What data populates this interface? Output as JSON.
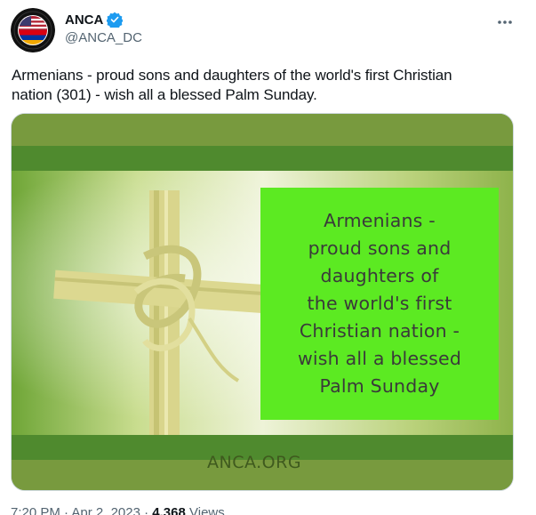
{
  "author": {
    "display_name": "ANCA",
    "handle": "@ANCA_DC",
    "verified": true,
    "avatar_icon": "anca-logo-avatar"
  },
  "tweet": {
    "text_line1": "Armenians - proud sons and daughters of the world's first Christian",
    "text_line2": "nation (301) - wish all a blessed Palm Sunday."
  },
  "media": {
    "banner_lines": [
      "Armenians -",
      "proud sons and",
      "daughters of",
      "the world's first",
      "Christian nation -",
      "wish all a blessed",
      "Palm Sunday"
    ],
    "site": "ANCA.ORG"
  },
  "meta": {
    "time": "7:20 PM",
    "date": "Apr 2, 2023",
    "separator": "·",
    "views_count": "4,368",
    "views_label": "Views"
  },
  "colors": {
    "verified_blue": "#1d9bf0",
    "banner_green": "#5cea22",
    "frame_green": "#6f8f3a"
  }
}
